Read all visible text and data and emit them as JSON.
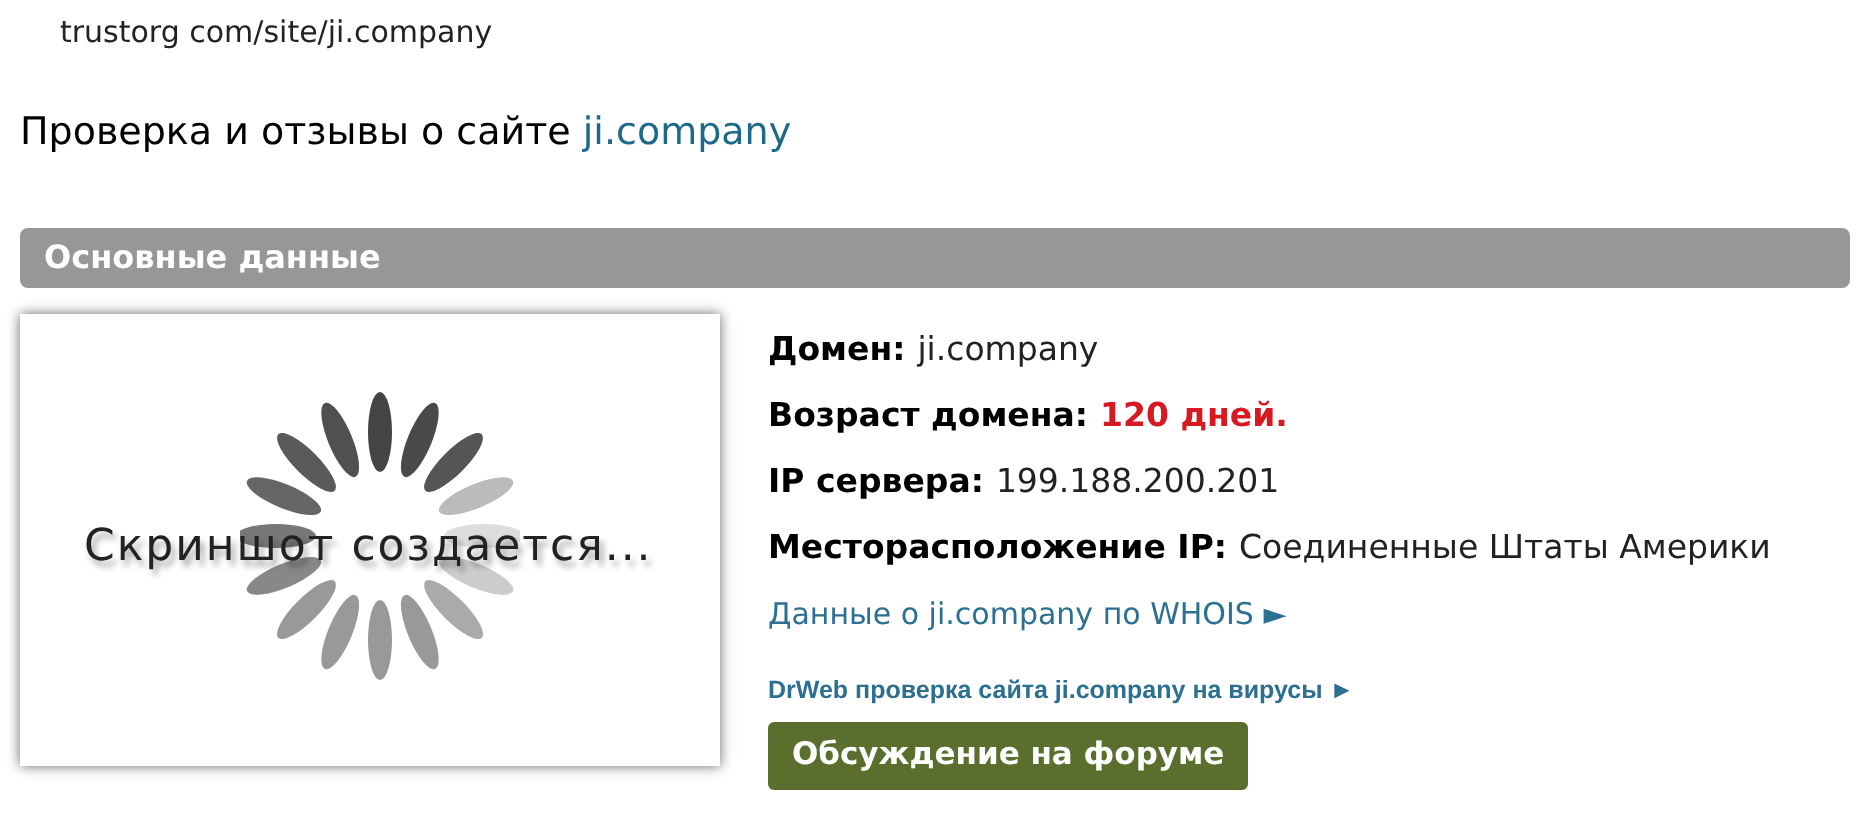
{
  "address": "trustorg com/site/ji.company",
  "heading": {
    "text": "Проверка и отзывы о сайте ",
    "site": "ji.company"
  },
  "section": {
    "title": "Основные данные"
  },
  "screenshot": {
    "caption": "Скриншот создается..."
  },
  "facts": [
    {
      "label": "Домен:",
      "value": "ji.company",
      "highlighted": false
    },
    {
      "label": "Возраст домена:",
      "value": "120 дней.",
      "highlighted": true
    },
    {
      "label": "IP сервера:",
      "value": "199.188.200.201",
      "highlighted": false
    },
    {
      "label": "Месторасположение IP:",
      "value": "Соединенные Штаты Америки",
      "highlighted": false
    }
  ],
  "links": [
    {
      "text": "Данные о ji.company по WHOIS ►",
      "kind": "large"
    },
    {
      "text": "DrWeb проверка сайта ji.company на вирусы ►",
      "kind": "small"
    }
  ],
  "button": "Обсуждение на форуме"
}
